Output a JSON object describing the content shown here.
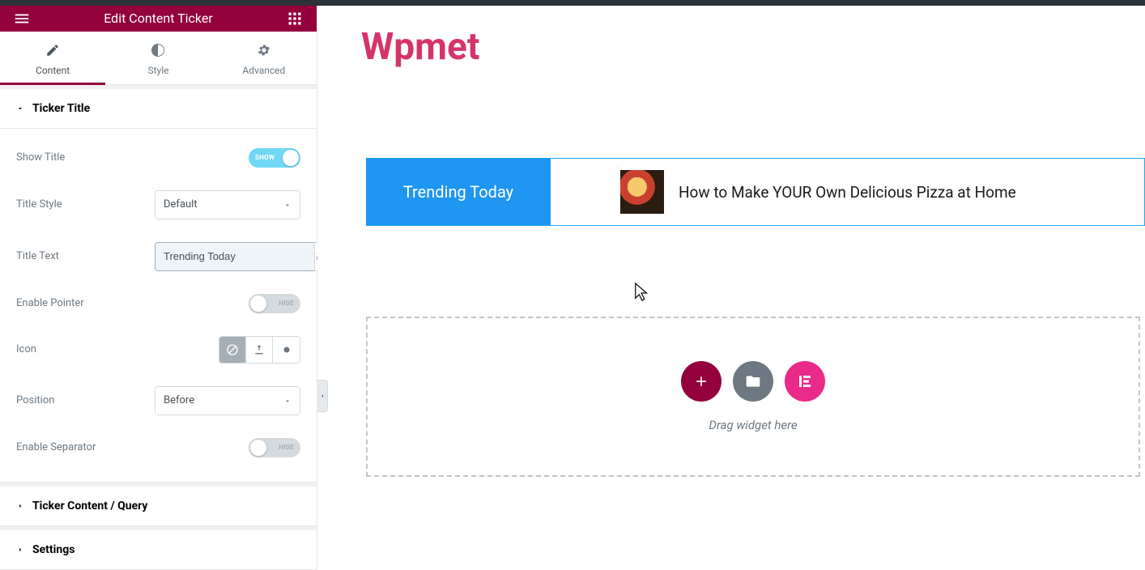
{
  "header": {
    "title": "Edit Content Ticker"
  },
  "tabs": {
    "content": "Content",
    "style": "Style",
    "advanced": "Advanced"
  },
  "sections": {
    "ticker_title": "Ticker Title",
    "ticker_content": "Ticker Content / Query",
    "settings": "Settings"
  },
  "controls": {
    "show_title": {
      "label": "Show Title",
      "state_label": "SHOW"
    },
    "title_style": {
      "label": "Title Style",
      "value": "Default"
    },
    "title_text": {
      "label": "Title Text",
      "value": "Trending Today"
    },
    "enable_pointer": {
      "label": "Enable Pointer",
      "state_label": "HIDE"
    },
    "icon": {
      "label": "Icon"
    },
    "position": {
      "label": "Position",
      "value": "Before"
    },
    "enable_separator": {
      "label": "Enable Separator",
      "state_label": "HIDE"
    }
  },
  "canvas": {
    "brand": "Wpmet",
    "ticker_title": "Trending Today",
    "ticker_item": "How to Make YOUR Own Delicious Pizza at Home",
    "drop_hint": "Drag widget here"
  }
}
